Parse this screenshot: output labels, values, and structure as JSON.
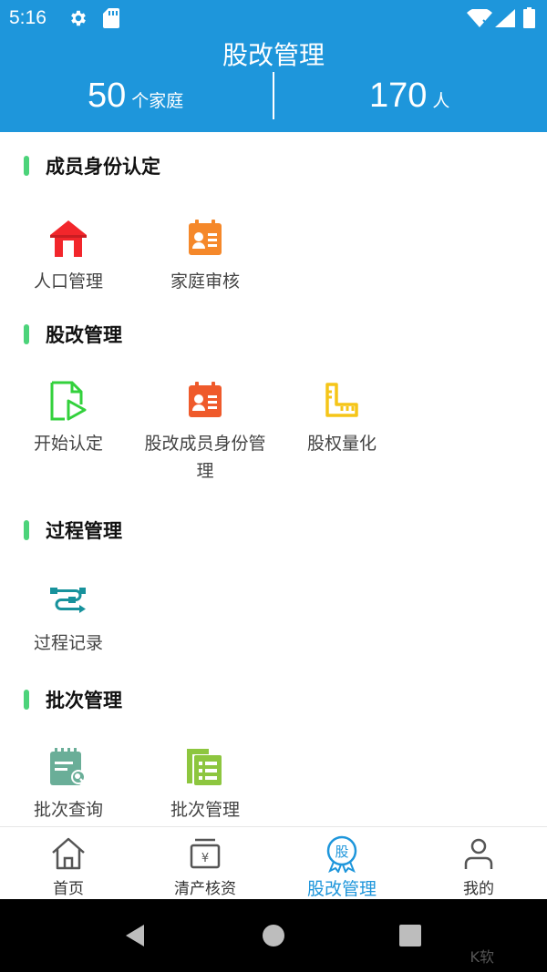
{
  "status": {
    "time": "5:16"
  },
  "header": {
    "title": "股改管理",
    "families_count": "50",
    "families_unit": "个家庭",
    "people_count": "170",
    "people_unit": "人"
  },
  "sections": [
    {
      "title": "成员身份认定",
      "items": [
        {
          "label": "人口管理",
          "icon": "house-icon"
        },
        {
          "label": "家庭审核",
          "icon": "id-card-icon"
        }
      ]
    },
    {
      "title": "股改管理",
      "items": [
        {
          "label": "开始认定",
          "icon": "document-play-icon"
        },
        {
          "label": "股改成员身份管理",
          "icon": "id-card-icon"
        },
        {
          "label": "股权量化",
          "icon": "ruler-icon"
        }
      ]
    },
    {
      "title": "过程管理",
      "items": [
        {
          "label": "过程记录",
          "icon": "process-flow-icon"
        }
      ]
    },
    {
      "title": "批次管理",
      "items": [
        {
          "label": "批次查询",
          "icon": "calendar-search-icon"
        },
        {
          "label": "批次管理",
          "icon": "list-document-icon"
        }
      ]
    }
  ],
  "bottom_nav": [
    {
      "label": "首页",
      "icon": "home-icon"
    },
    {
      "label": "清产核资",
      "icon": "cash-register-icon"
    },
    {
      "label": "股改管理",
      "icon": "share-badge-icon",
      "badge_text": "股"
    },
    {
      "label": "我的",
      "icon": "user-icon"
    }
  ],
  "colors": {
    "primary": "#1e96db",
    "section_bar": "#4cd37a",
    "red": "#f2262b",
    "orange": "#f5882a",
    "deep_orange": "#ef5a2b",
    "green": "#33d13c",
    "yellow": "#f5c518",
    "teal": "#17929c",
    "sage": "#6aae98",
    "lime": "#8dc63f"
  },
  "watermark": "K软"
}
